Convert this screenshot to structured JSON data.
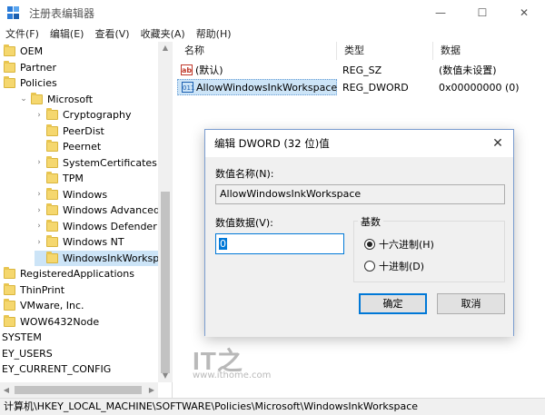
{
  "window": {
    "title": "注册表编辑器",
    "controls": [
      "—",
      "☐",
      "✕"
    ]
  },
  "menu": [
    "文件(F)",
    "编辑(E)",
    "查看(V)",
    "收藏夹(A)",
    "帮助(H)"
  ],
  "tree": [
    {
      "label": "OEM",
      "indent": 0,
      "arrow": "",
      "folder": true
    },
    {
      "label": "Partner",
      "indent": 0,
      "arrow": "",
      "folder": true
    },
    {
      "label": "Policies",
      "indent": 0,
      "arrow": "",
      "folder": true
    },
    {
      "label": "Microsoft",
      "indent": 1,
      "arrow": "v",
      "folder": true
    },
    {
      "label": "Cryptography",
      "indent": 2,
      "arrow": ">",
      "folder": true
    },
    {
      "label": "PeerDist",
      "indent": 2,
      "arrow": "",
      "folder": true
    },
    {
      "label": "Peernet",
      "indent": 2,
      "arrow": "",
      "folder": true
    },
    {
      "label": "SystemCertificates",
      "indent": 2,
      "arrow": ">",
      "folder": true
    },
    {
      "label": "TPM",
      "indent": 2,
      "arrow": "",
      "folder": true
    },
    {
      "label": "Windows",
      "indent": 2,
      "arrow": ">",
      "folder": true
    },
    {
      "label": "Windows Advanced Thr",
      "indent": 2,
      "arrow": ">",
      "folder": true
    },
    {
      "label": "Windows Defender",
      "indent": 2,
      "arrow": ">",
      "folder": true
    },
    {
      "label": "Windows NT",
      "indent": 2,
      "arrow": ">",
      "folder": true
    },
    {
      "label": "WindowsInkWorkspace",
      "indent": 2,
      "arrow": "",
      "folder": true,
      "selected": true
    },
    {
      "label": "RegisteredApplications",
      "indent": 0,
      "arrow": "",
      "folder": true
    },
    {
      "label": "ThinPrint",
      "indent": 0,
      "arrow": "",
      "folder": true
    },
    {
      "label": "VMware, Inc.",
      "indent": 0,
      "arrow": "",
      "folder": true
    },
    {
      "label": "WOW6432Node",
      "indent": 0,
      "arrow": "",
      "folder": true
    },
    {
      "label": "SYSTEM",
      "indent": -1,
      "arrow": "",
      "folder": false
    },
    {
      "label": "EY_USERS",
      "indent": -1,
      "arrow": "",
      "folder": false
    },
    {
      "label": "EY_CURRENT_CONFIG",
      "indent": -1,
      "arrow": "",
      "folder": false
    }
  ],
  "list": {
    "headers": [
      "名称",
      "类型",
      "数据"
    ],
    "rows": [
      {
        "icon": "ab",
        "icon_kind": "sz",
        "name": "(默认)",
        "type": "REG_SZ",
        "data": "(数值未设置)"
      },
      {
        "icon": "011",
        "icon_kind": "bin",
        "name": "AllowWindowsInkWorkspace",
        "type": "REG_DWORD",
        "data": "0x00000000 (0)",
        "selected": true
      }
    ]
  },
  "status": "计算机\\HKEY_LOCAL_MACHINE\\SOFTWARE\\Policies\\Microsoft\\WindowsInkWorkspace",
  "dialog": {
    "title": "编辑 DWORD (32 位)值",
    "name_label": "数值名称(N):",
    "name_value": "AllowWindowsInkWorkspace",
    "data_label": "数值数据(V):",
    "data_value": "0",
    "base_label": "基数",
    "radio_hex": "十六进制(H)",
    "radio_dec": "十进制(D)",
    "selected_base": "hex",
    "ok": "确定",
    "cancel": "取消"
  },
  "watermark": {
    "big": "IT之",
    "small": "www.ithome.com"
  }
}
